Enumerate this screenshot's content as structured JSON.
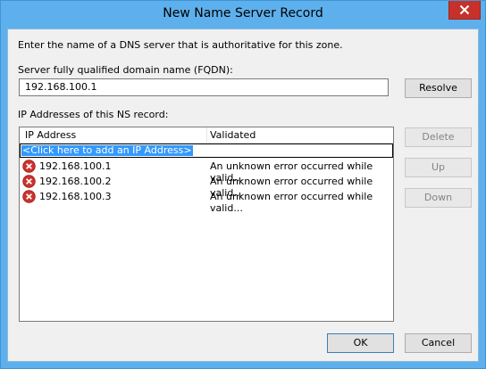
{
  "window": {
    "title": "New Name Server Record"
  },
  "intro": "Enter the name of a DNS server that is authoritative for this zone.",
  "fqdn": {
    "label": "Server fully qualified domain name (FQDN):",
    "value": "192.168.100.1"
  },
  "buttons": {
    "resolve": "Resolve",
    "delete": "Delete",
    "up": "Up",
    "down": "Down",
    "ok": "OK",
    "cancel": "Cancel"
  },
  "ip_list": {
    "label": "IP Addresses of this NS record:",
    "columns": [
      "IP Address",
      "Validated"
    ],
    "add_placeholder": "<Click here to add an IP Address>",
    "rows": [
      {
        "ip": "192.168.100.1",
        "validated": "An unknown error occurred while valid..."
      },
      {
        "ip": "192.168.100.2",
        "validated": "An unknown error occurred while valid..."
      },
      {
        "ip": "192.168.100.3",
        "validated": "An unknown error occurred while valid..."
      }
    ]
  },
  "colors": {
    "title_bar": "#5db0ec",
    "close_button": "#c7312b",
    "selection": "#3399ff",
    "error_icon": "#d0312d"
  },
  "icons": {
    "close": "close-icon",
    "row_status": "error-icon"
  }
}
